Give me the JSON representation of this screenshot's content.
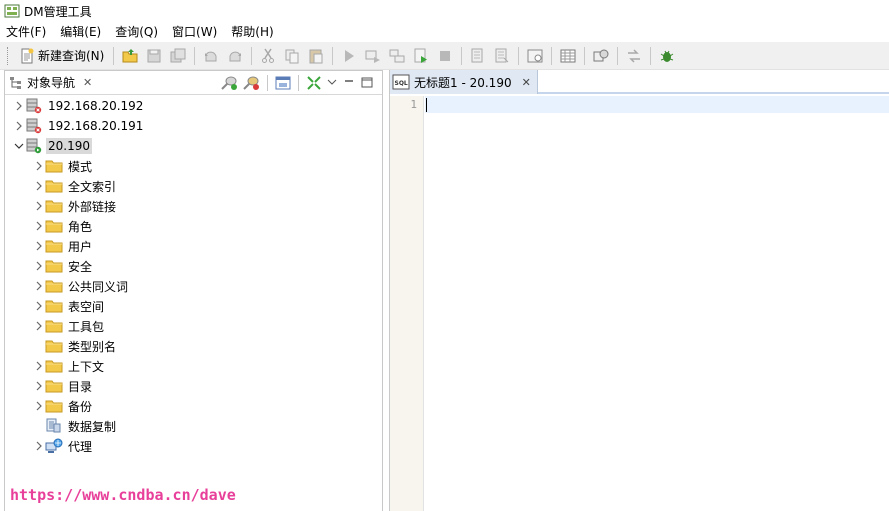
{
  "window": {
    "title": "DM管理工具"
  },
  "menu": [
    {
      "label": "文件(F)"
    },
    {
      "label": "编辑(E)"
    },
    {
      "label": "查询(Q)"
    },
    {
      "label": "窗口(W)"
    },
    {
      "label": "帮助(H)"
    }
  ],
  "toolbar": {
    "new_query_label": "新建查询(N)"
  },
  "navigator": {
    "tab_label": "对象导航",
    "tree": [
      {
        "label": "192.168.20.192",
        "level": 0,
        "icon": "server-disconnected-icon",
        "expand": "collapsed"
      },
      {
        "label": "192.168.20.191",
        "level": 0,
        "icon": "server-disconnected-icon",
        "expand": "collapsed"
      },
      {
        "label": "20.190",
        "level": 0,
        "icon": "server-connected-icon",
        "expand": "expanded",
        "selected": true
      },
      {
        "label": "模式",
        "level": 1,
        "icon": "folder-icon",
        "expand": "collapsed"
      },
      {
        "label": "全文索引",
        "level": 1,
        "icon": "folder-icon",
        "expand": "collapsed"
      },
      {
        "label": "外部链接",
        "level": 1,
        "icon": "folder-icon",
        "expand": "collapsed"
      },
      {
        "label": "角色",
        "level": 1,
        "icon": "folder-icon",
        "expand": "collapsed"
      },
      {
        "label": "用户",
        "level": 1,
        "icon": "folder-icon",
        "expand": "collapsed"
      },
      {
        "label": "安全",
        "level": 1,
        "icon": "folder-icon",
        "expand": "collapsed"
      },
      {
        "label": "公共同义词",
        "level": 1,
        "icon": "folder-icon",
        "expand": "collapsed"
      },
      {
        "label": "表空间",
        "level": 1,
        "icon": "folder-icon",
        "expand": "collapsed"
      },
      {
        "label": "工具包",
        "level": 1,
        "icon": "folder-icon",
        "expand": "collapsed"
      },
      {
        "label": "类型别名",
        "level": 1,
        "icon": "folder-icon",
        "expand": "none"
      },
      {
        "label": "上下文",
        "level": 1,
        "icon": "folder-icon",
        "expand": "collapsed"
      },
      {
        "label": "目录",
        "level": 1,
        "icon": "folder-icon",
        "expand": "collapsed"
      },
      {
        "label": "备份",
        "level": 1,
        "icon": "folder-icon",
        "expand": "collapsed"
      },
      {
        "label": "数据复制",
        "level": 1,
        "icon": "replication-icon",
        "expand": "none"
      },
      {
        "label": "代理",
        "level": 1,
        "icon": "agent-icon",
        "expand": "collapsed"
      }
    ]
  },
  "editor": {
    "tab_label": "无标题1 - 20.190",
    "line_numbers": [
      "1"
    ]
  },
  "watermark": {
    "text": "https://www.cndba.cn/dave"
  },
  "colors": {
    "watermark": "#e8409a",
    "folder": "#f3c94a",
    "editor_tab": "#dfe8f3",
    "current_line": "#e8f2fe"
  }
}
